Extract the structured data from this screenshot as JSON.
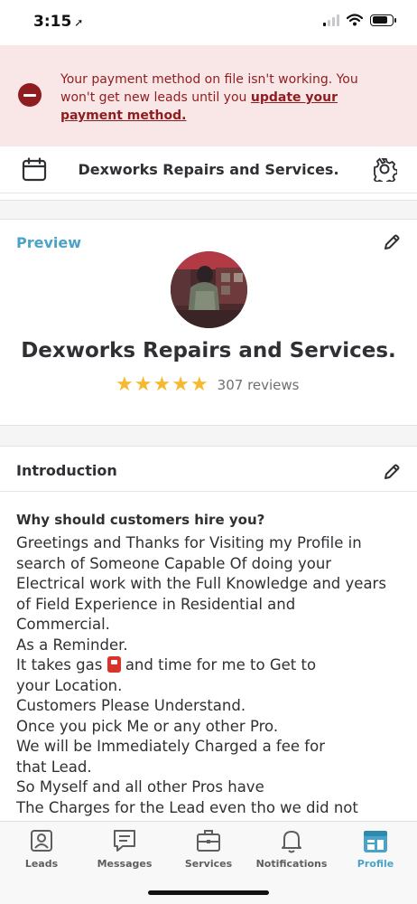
{
  "status_bar": {
    "time": "3:15"
  },
  "alert": {
    "message": "Your payment method on file isn't working. You won't get new leads until you ",
    "link_text": "update your payment method."
  },
  "header": {
    "title": "Dexworks Repairs and Services."
  },
  "preview": {
    "label": "Preview",
    "name": "Dexworks Repairs and Services.",
    "rating": 5,
    "reviews_text": "307 reviews"
  },
  "introduction": {
    "title": "Introduction",
    "question": "Why should customers hire you?",
    "answer_lines": [
      "Greetings and Thanks for Visiting my Profile in",
      "search of Someone Capable Of doing your",
      "Electrical work with the Full Knowledge and years",
      "of Field Experience in Residential and",
      "Commercial.",
      "As a Reminder.",
      "It takes gas",
      "and time for me to Get to",
      "your Location.",
      "Customers Please Understand.",
      "Once  you pick Me or any other Pro.",
      "We will be Immediately Charged a fee for",
      "that Lead.",
      "So Myself and all other Pros have",
      "The Charges for the Lead even tho we did not"
    ]
  },
  "tabs": [
    {
      "label": "Leads",
      "icon": "person-icon"
    },
    {
      "label": "Messages",
      "icon": "message-icon"
    },
    {
      "label": "Services",
      "icon": "briefcase-icon"
    },
    {
      "label": "Notifications",
      "icon": "bell-icon"
    },
    {
      "label": "Profile",
      "icon": "storefront-icon",
      "active": true
    }
  ],
  "colors": {
    "accent": "#4aa3c8",
    "alert_bg": "#f9e7e7",
    "alert_text": "#8f1d1f",
    "star": "#f5b82e"
  }
}
